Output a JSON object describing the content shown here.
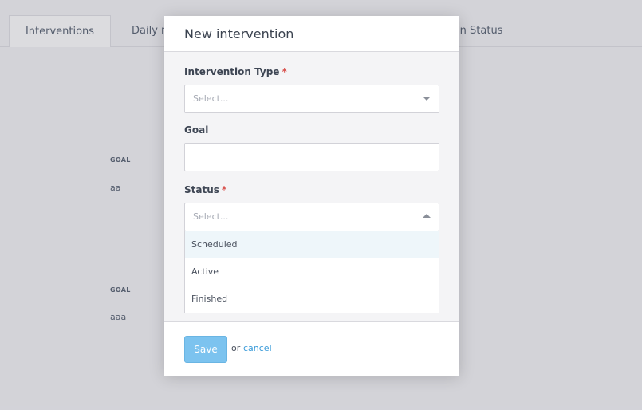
{
  "background": {
    "tabs": [
      {
        "label": "Interventions"
      },
      {
        "label": "Daily re"
      },
      {
        "label": "tion Status"
      }
    ],
    "sections": [
      {
        "column_header": "GOAL",
        "value": "aa"
      },
      {
        "column_header": "GOAL",
        "value": "aaa"
      }
    ]
  },
  "modal": {
    "title": "New intervention",
    "fields": {
      "intervention_type": {
        "label": "Intervention Type",
        "required_mark": "*",
        "placeholder": "Select..."
      },
      "goal": {
        "label": "Goal",
        "value": ""
      },
      "status": {
        "label": "Status",
        "required_mark": "*",
        "placeholder": "Select...",
        "options": [
          "Scheduled",
          "Active",
          "Finished"
        ],
        "highlighted": "Scheduled"
      }
    },
    "footer": {
      "save_label": "Save",
      "or_text": "or",
      "cancel_label": "cancel"
    }
  },
  "colors": {
    "accent": "#7cc3ef",
    "link": "#3a9bd9",
    "required": "#d9534f"
  }
}
